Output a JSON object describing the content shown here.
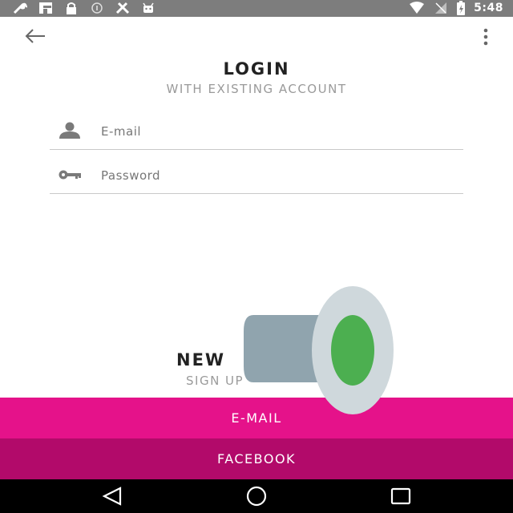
{
  "status_bar": {
    "time": "5:48",
    "left_icons": [
      "wrench-icon",
      "flipboard-icon",
      "lock-icon",
      "info-icon",
      "tools-icon",
      "android-icon"
    ],
    "right_icons": [
      "wifi-icon",
      "signal-icon",
      "battery-icon"
    ]
  },
  "app_bar": {
    "back_icon": "arrow-back-icon",
    "menu_icon": "more-vert-icon"
  },
  "login": {
    "title": "LOGIN",
    "subtitle": "WITH EXISTING ACCOUNT",
    "email": {
      "placeholder": "E-mail",
      "value": "",
      "icon": "person-icon"
    },
    "password": {
      "placeholder": "Password",
      "value": "",
      "icon": "key-icon"
    }
  },
  "signup": {
    "title": "NEW",
    "subtitle": "SIGN UP"
  },
  "buttons": {
    "email": "E-MAIL",
    "facebook": "FACEBOOK"
  },
  "nav_bar": {
    "icons": [
      "back-triangle-icon",
      "home-circle-icon",
      "recents-square-icon"
    ]
  },
  "colors": {
    "email_button": "#e5128a",
    "facebook_button": "#b20a6a",
    "status_bar": "#7d7d7d",
    "overlay_accent": "#4caf50"
  }
}
